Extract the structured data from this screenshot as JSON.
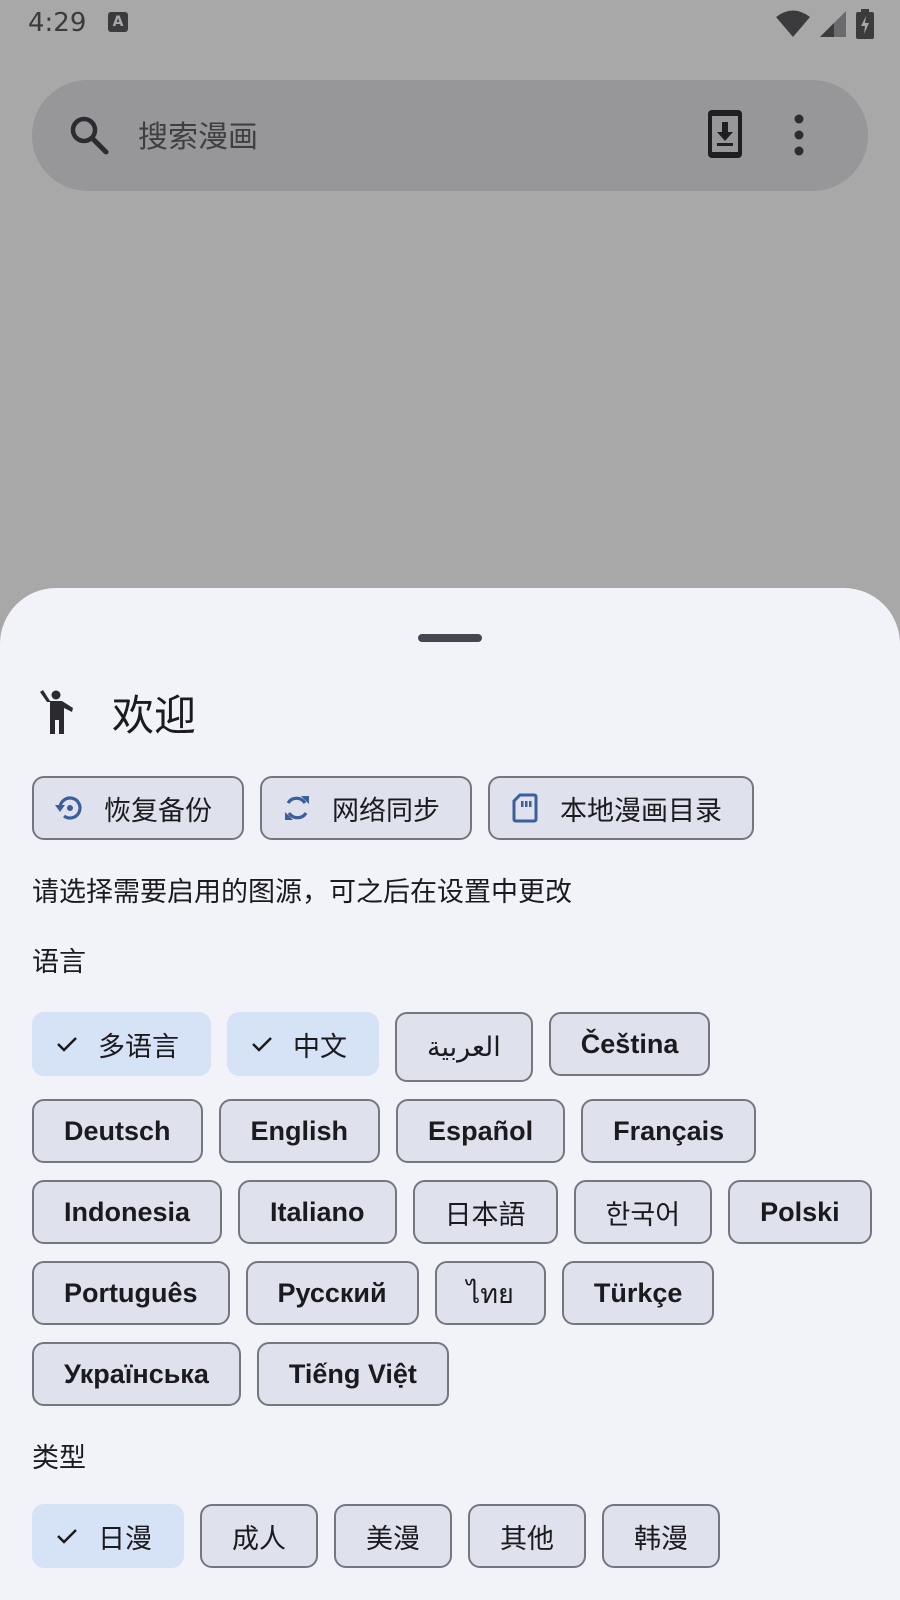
{
  "status_bar": {
    "time": "4:29",
    "notification_icon": "A"
  },
  "search": {
    "placeholder": "搜索漫画",
    "icons": [
      "search-icon",
      "download-icon",
      "more-vert-icon"
    ]
  },
  "sheet": {
    "title": "欢迎",
    "actions": [
      {
        "label": "恢复备份",
        "icon": "restore-icon"
      },
      {
        "label": "网络同步",
        "icon": "sync-icon"
      },
      {
        "label": "本地漫画目录",
        "icon": "sd-card-icon"
      }
    ],
    "hint": "请选择需要启用的图源，可之后在设置中更改",
    "language_label": "语言",
    "languages": [
      {
        "label": "多语言",
        "selected": true
      },
      {
        "label": "中文",
        "selected": true
      },
      {
        "label": "العربية",
        "selected": false
      },
      {
        "label": "Čeština",
        "selected": false
      },
      {
        "label": "Deutsch",
        "selected": false
      },
      {
        "label": "English",
        "selected": false
      },
      {
        "label": "Español",
        "selected": false
      },
      {
        "label": "Français",
        "selected": false
      },
      {
        "label": "Indonesia",
        "selected": false
      },
      {
        "label": "Italiano",
        "selected": false
      },
      {
        "label": "日本語",
        "selected": false
      },
      {
        "label": "한국어",
        "selected": false
      },
      {
        "label": "Polski",
        "selected": false
      },
      {
        "label": "Português",
        "selected": false
      },
      {
        "label": "Русский",
        "selected": false
      },
      {
        "label": "ไทย",
        "selected": false
      },
      {
        "label": "Türkçe",
        "selected": false
      },
      {
        "label": "Українська",
        "selected": false
      },
      {
        "label": "Tiếng Việt",
        "selected": false
      }
    ],
    "type_label": "类型",
    "types": [
      {
        "label": "日漫",
        "selected": true
      },
      {
        "label": "成人",
        "selected": false
      },
      {
        "label": "美漫",
        "selected": false
      },
      {
        "label": "其他",
        "selected": false
      },
      {
        "label": "韩漫",
        "selected": false
      }
    ]
  },
  "colors": {
    "scrim": "#a8a8a9",
    "sheet_bg": "#f2f3f9",
    "chip_bg": "#dfe2ec",
    "chip_selected_bg": "#d6e2f6",
    "outline": "#757780",
    "icon_accent": "#3b5f9a"
  }
}
